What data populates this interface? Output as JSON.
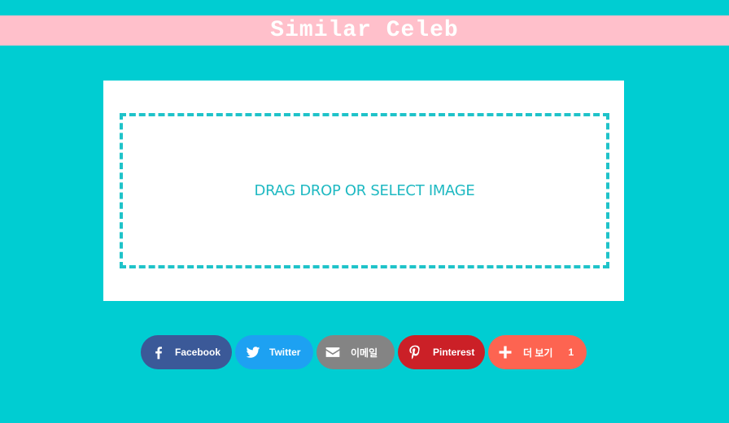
{
  "header": {
    "title": "Similar Celeb"
  },
  "upload": {
    "label": "DRAG DROP OR SELECT IMAGE"
  },
  "share": {
    "buttons": [
      {
        "id": "facebook",
        "label": "Facebook",
        "icon": "facebook-icon",
        "color": "#3b5998"
      },
      {
        "id": "twitter",
        "label": "Twitter",
        "icon": "twitter-icon",
        "color": "#1da1f2"
      },
      {
        "id": "email",
        "label": "이메일",
        "icon": "envelope-icon",
        "color": "#848484"
      },
      {
        "id": "pinterest",
        "label": "Pinterest",
        "icon": "pinterest-icon",
        "color": "#cb2027"
      },
      {
        "id": "more",
        "label": "더 보기",
        "icon": "plus-icon",
        "color": "#fd6451",
        "count": "1"
      }
    ]
  },
  "colors": {
    "background": "#00cdd2",
    "header_background": "#ffc0cb",
    "dropzone_accent": "#1fc3c9"
  }
}
